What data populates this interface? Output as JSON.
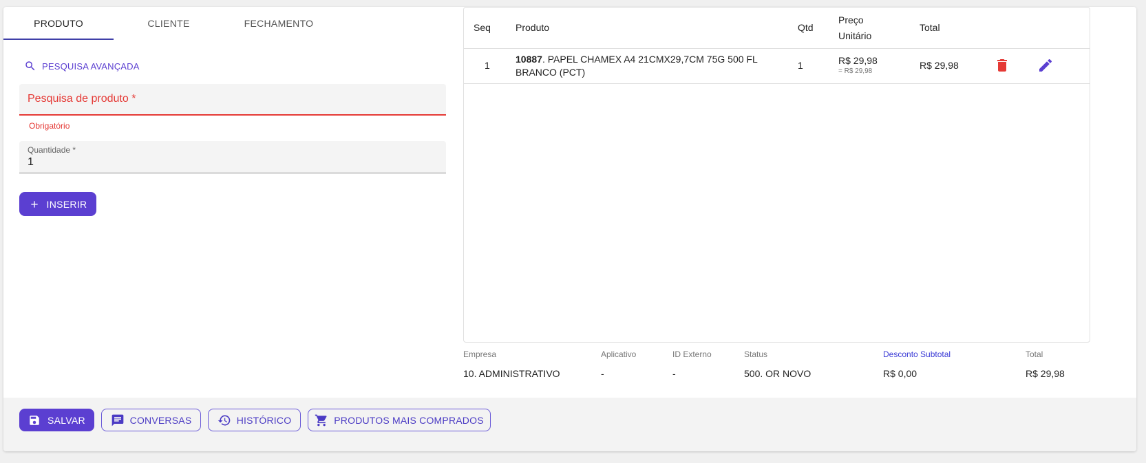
{
  "tabs": [
    {
      "label": "PRODUTO",
      "active": true
    },
    {
      "label": "CLIENTE",
      "active": false
    },
    {
      "label": "FECHAMENTO",
      "active": false
    }
  ],
  "form": {
    "advanced_search_label": "PESQUISA AVANÇADA",
    "product_search_label": "Pesquisa de produto *",
    "product_search_error": "Obrigatório",
    "quantity_label": "Quantidade *",
    "quantity_value": "1",
    "insert_button": "INSERIR"
  },
  "table": {
    "headers": {
      "seq": "Seq",
      "product": "Produto",
      "qty": "Qtd",
      "unit_price_line1": "Preço",
      "unit_price_line2": "Unitário",
      "total": "Total"
    },
    "rows": [
      {
        "seq": "1",
        "product_code": "10887",
        "product_desc_line1": ". PAPEL CHAMEX A4 21CMX29,7CM 75G 500 FL",
        "product_desc_line2": "BRANCO (PCT)",
        "qty": "1",
        "unit_price": "R$ 29,98",
        "unit_price_sub": "= R$ 29,98",
        "total": "R$ 29,98"
      }
    ]
  },
  "summary": {
    "empresa_label": "Empresa",
    "empresa_value": "10. ADMINISTRATIVO",
    "aplicativo_label": "Aplicativo",
    "aplicativo_value": "-",
    "id_externo_label": "ID Externo",
    "id_externo_value": "-",
    "status_label": "Status",
    "status_value": "500. OR NOVO",
    "desconto_label": "Desconto Subtotal",
    "desconto_value": "R$ 0,00",
    "total_label": "Total",
    "total_value": "R$ 29,98"
  },
  "footer": {
    "save_button": "SALVAR",
    "conversas_button": "CONVERSAS",
    "historico_button": "HISTÓRICO",
    "produtos_button": "PRODUTOS MAIS COMPRADOS"
  },
  "colors": {
    "primary": "#5b3fd1",
    "error": "#e53935",
    "delete_icon": "#e53935",
    "edit_icon": "#5b3fd1"
  }
}
